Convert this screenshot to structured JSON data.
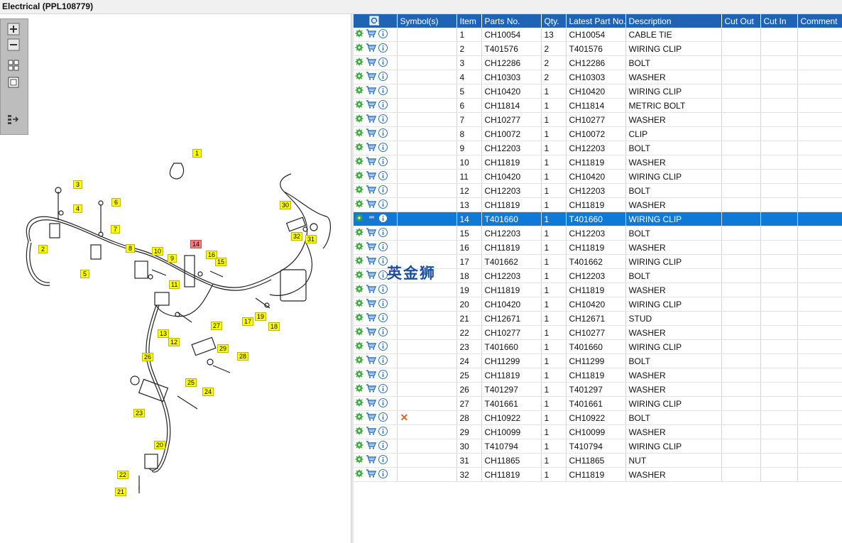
{
  "window": {
    "title": "Electrical (PPL108779)"
  },
  "toolbar": {
    "buttons": [
      "zoom-in-icon",
      "zoom-out-icon",
      "fit-all-icon",
      "fit-window-icon",
      "export-list-icon"
    ]
  },
  "watermark": "英金狮",
  "grid": {
    "columns": [
      "Symbol(s)",
      "Item",
      "Parts No.",
      "Qty.",
      "Latest Part No.",
      "Description",
      "Cut Out",
      "Cut In",
      "Comment"
    ],
    "selected_item": "14",
    "rows": [
      {
        "symbol": "",
        "item": "1",
        "part": "CH10054",
        "qty": "13",
        "latest": "CH10054",
        "desc": "CABLE TIE"
      },
      {
        "symbol": "",
        "item": "2",
        "part": "T401576",
        "qty": "2",
        "latest": "T401576",
        "desc": "WIRING CLIP"
      },
      {
        "symbol": "",
        "item": "3",
        "part": "CH12286",
        "qty": "2",
        "latest": "CH12286",
        "desc": "BOLT"
      },
      {
        "symbol": "",
        "item": "4",
        "part": "CH10303",
        "qty": "2",
        "latest": "CH10303",
        "desc": "WASHER"
      },
      {
        "symbol": "",
        "item": "5",
        "part": "CH10420",
        "qty": "1",
        "latest": "CH10420",
        "desc": "WIRING CLIP"
      },
      {
        "symbol": "",
        "item": "6",
        "part": "CH11814",
        "qty": "1",
        "latest": "CH11814",
        "desc": "METRIC BOLT"
      },
      {
        "symbol": "",
        "item": "7",
        "part": "CH10277",
        "qty": "1",
        "latest": "CH10277",
        "desc": "WASHER"
      },
      {
        "symbol": "",
        "item": "8",
        "part": "CH10072",
        "qty": "1",
        "latest": "CH10072",
        "desc": "CLIP"
      },
      {
        "symbol": "",
        "item": "9",
        "part": "CH12203",
        "qty": "1",
        "latest": "CH12203",
        "desc": "BOLT"
      },
      {
        "symbol": "",
        "item": "10",
        "part": "CH11819",
        "qty": "1",
        "latest": "CH11819",
        "desc": "WASHER"
      },
      {
        "symbol": "",
        "item": "11",
        "part": "CH10420",
        "qty": "1",
        "latest": "CH10420",
        "desc": "WIRING CLIP"
      },
      {
        "symbol": "",
        "item": "12",
        "part": "CH12203",
        "qty": "1",
        "latest": "CH12203",
        "desc": "BOLT"
      },
      {
        "symbol": "",
        "item": "13",
        "part": "CH11819",
        "qty": "1",
        "latest": "CH11819",
        "desc": "WASHER"
      },
      {
        "symbol": "",
        "item": "14",
        "part": "T401660",
        "qty": "1",
        "latest": "T401660",
        "desc": "WIRING CLIP"
      },
      {
        "symbol": "",
        "item": "15",
        "part": "CH12203",
        "qty": "1",
        "latest": "CH12203",
        "desc": "BOLT"
      },
      {
        "symbol": "",
        "item": "16",
        "part": "CH11819",
        "qty": "1",
        "latest": "CH11819",
        "desc": "WASHER"
      },
      {
        "symbol": "",
        "item": "17",
        "part": "T401662",
        "qty": "1",
        "latest": "T401662",
        "desc": "WIRING CLIP"
      },
      {
        "symbol": "",
        "item": "18",
        "part": "CH12203",
        "qty": "1",
        "latest": "CH12203",
        "desc": "BOLT"
      },
      {
        "symbol": "",
        "item": "19",
        "part": "CH11819",
        "qty": "1",
        "latest": "CH11819",
        "desc": "WASHER"
      },
      {
        "symbol": "",
        "item": "20",
        "part": "CH10420",
        "qty": "1",
        "latest": "CH10420",
        "desc": "WIRING CLIP"
      },
      {
        "symbol": "",
        "item": "21",
        "part": "CH12671",
        "qty": "1",
        "latest": "CH12671",
        "desc": "STUD"
      },
      {
        "symbol": "",
        "item": "22",
        "part": "CH10277",
        "qty": "1",
        "latest": "CH10277",
        "desc": "WASHER"
      },
      {
        "symbol": "",
        "item": "23",
        "part": "T401660",
        "qty": "1",
        "latest": "T401660",
        "desc": "WIRING CLIP"
      },
      {
        "symbol": "",
        "item": "24",
        "part": "CH11299",
        "qty": "1",
        "latest": "CH11299",
        "desc": "BOLT"
      },
      {
        "symbol": "",
        "item": "25",
        "part": "CH11819",
        "qty": "1",
        "latest": "CH11819",
        "desc": "WASHER"
      },
      {
        "symbol": "",
        "item": "26",
        "part": "T401297",
        "qty": "1",
        "latest": "T401297",
        "desc": "WASHER"
      },
      {
        "symbol": "",
        "item": "27",
        "part": "T401661",
        "qty": "1",
        "latest": "T401661",
        "desc": "WIRING CLIP"
      },
      {
        "symbol": "✕",
        "item": "28",
        "part": "CH10922",
        "qty": "1",
        "latest": "CH10922",
        "desc": "BOLT"
      },
      {
        "symbol": "",
        "item": "29",
        "part": "CH10099",
        "qty": "1",
        "latest": "CH10099",
        "desc": "WASHER"
      },
      {
        "symbol": "",
        "item": "30",
        "part": "T410794",
        "qty": "1",
        "latest": "T410794",
        "desc": "WIRING CLIP"
      },
      {
        "symbol": "",
        "item": "31",
        "part": "CH11865",
        "qty": "1",
        "latest": "CH11865",
        "desc": "NUT"
      },
      {
        "symbol": "",
        "item": "32",
        "part": "CH11819",
        "qty": "1",
        "latest": "CH11819",
        "desc": "WASHER"
      }
    ]
  },
  "diagram": {
    "callouts": [
      "1",
      "2",
      "3",
      "4",
      "5",
      "6",
      "7",
      "8",
      "9",
      "10",
      "11",
      "12",
      "13",
      "14",
      "15",
      "16",
      "17",
      "18",
      "19",
      "20",
      "21",
      "22",
      "23",
      "24",
      "25",
      "26",
      "27",
      "28",
      "29",
      "30",
      "31",
      "32"
    ],
    "highlighted": "14"
  },
  "colors": {
    "header_blue": "#1f63b5",
    "selected_row": "#0f79d8",
    "callout_yellow": "#ffff00",
    "callout_highlight": "#f08080"
  }
}
